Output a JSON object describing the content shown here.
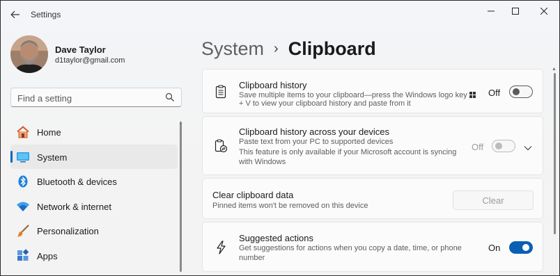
{
  "window": {
    "title": "Settings",
    "controls": [
      "minimize",
      "maximize",
      "close"
    ]
  },
  "user": {
    "name": "Dave Taylor",
    "email": "d1taylor@gmail.com"
  },
  "search": {
    "placeholder": "Find a setting"
  },
  "nav": [
    {
      "label": "Home",
      "icon": "home-icon",
      "active": false
    },
    {
      "label": "System",
      "icon": "system-icon",
      "active": true
    },
    {
      "label": "Bluetooth & devices",
      "icon": "bluetooth-icon",
      "active": false
    },
    {
      "label": "Network & internet",
      "icon": "wifi-icon",
      "active": false
    },
    {
      "label": "Personalization",
      "icon": "brush-icon",
      "active": false
    },
    {
      "label": "Apps",
      "icon": "apps-icon",
      "active": false
    }
  ],
  "breadcrumb": {
    "parent": "System",
    "separator": "›",
    "current": "Clipboard"
  },
  "settings": {
    "clipboard_history": {
      "title": "Clipboard history",
      "desc_line1": "Save multiple items to your clipboard—press the Windows logo key",
      "desc_line2": "+ V to view your clipboard history and paste from it",
      "state_label": "Off",
      "state": "off"
    },
    "across_devices": {
      "title": "Clipboard history across your devices",
      "desc_line1": "Paste text from your PC to supported devices",
      "desc_line2": "This feature is only available if your Microsoft account is syncing",
      "desc_line3": "with Windows",
      "state_label": "Off",
      "state": "disabled"
    },
    "clear_data": {
      "title": "Clear clipboard data",
      "desc": "Pinned items won't be removed on this device",
      "button_label": "Clear"
    },
    "suggested_actions": {
      "title": "Suggested actions",
      "desc_line1": "Get suggestions for actions when you copy a date, time, or phone",
      "desc_line2": "number",
      "state_label": "On",
      "state": "on"
    }
  },
  "colors": {
    "accent": "#0067c0",
    "toggle_on": "#0a5fb4"
  }
}
